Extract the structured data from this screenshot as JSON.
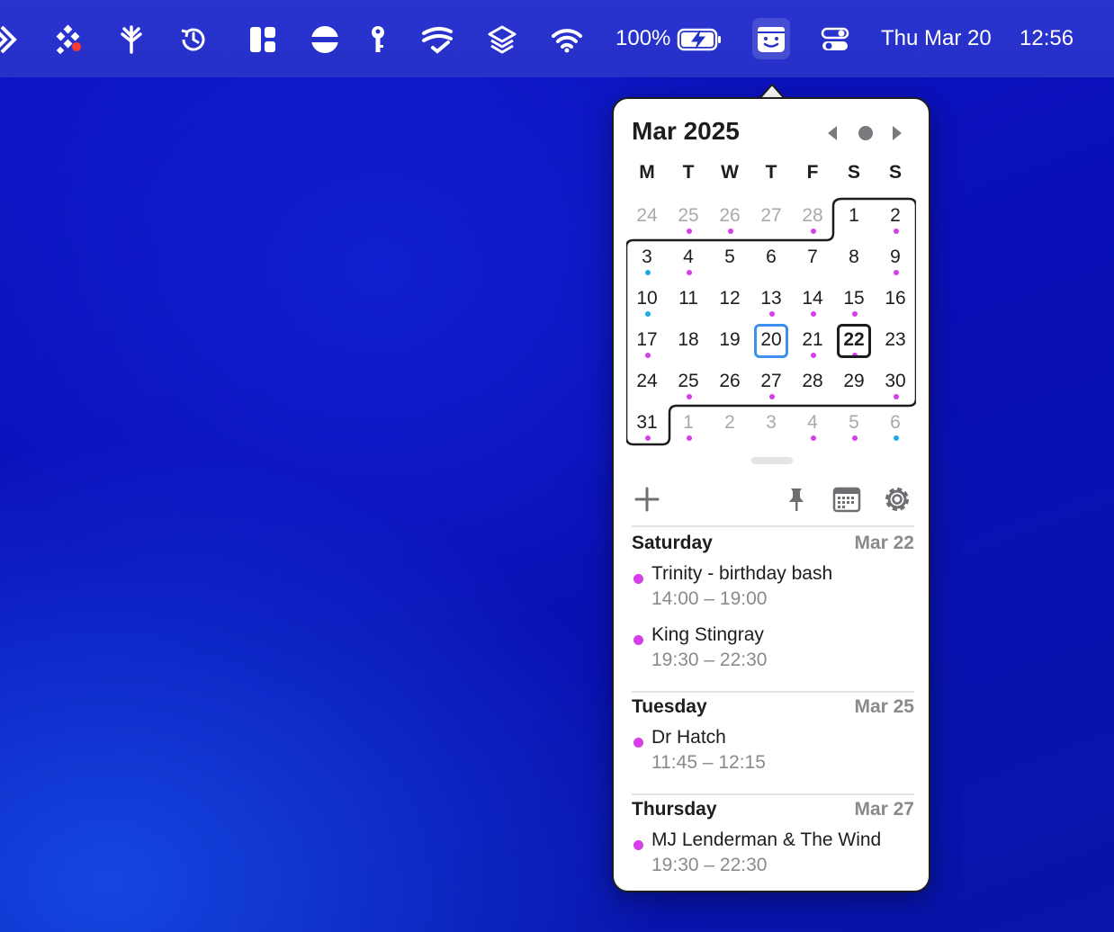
{
  "menubar": {
    "battery_percent": "100%",
    "battery_level": 1.0,
    "date": "Thu Mar 20",
    "time": "12:56",
    "icons": [
      "status-app-icon",
      "grid-notification-icon",
      "bluetooth-fork-icon",
      "time-machine-icon",
      "layout-icon",
      "minus-circle-icon",
      "key-icon",
      "stacked-check-icon",
      "layers-icon",
      "wifi-icon",
      "battery-charging-icon",
      "itsycal-face-icon",
      "control-center-icon"
    ],
    "colors": {
      "notification_dot": "#ff3b30"
    }
  },
  "calendar": {
    "title": "Mar 2025",
    "weekdays": [
      "M",
      "T",
      "W",
      "T",
      "F",
      "S",
      "S"
    ],
    "weeks": [
      [
        {
          "d": "24",
          "other": true
        },
        {
          "d": "25",
          "other": true,
          "dot": "purple"
        },
        {
          "d": "26",
          "other": true,
          "dot": "purple"
        },
        {
          "d": "27",
          "other": true
        },
        {
          "d": "28",
          "other": true,
          "dot": "purple"
        },
        {
          "d": "1"
        },
        {
          "d": "2",
          "dot": "purple"
        }
      ],
      [
        {
          "d": "3",
          "dot": "blue"
        },
        {
          "d": "4",
          "dot": "purple"
        },
        {
          "d": "5"
        },
        {
          "d": "6"
        },
        {
          "d": "7"
        },
        {
          "d": "8"
        },
        {
          "d": "9",
          "dot": "purple"
        }
      ],
      [
        {
          "d": "10",
          "dot": "blue"
        },
        {
          "d": "11"
        },
        {
          "d": "12"
        },
        {
          "d": "13",
          "dot": "purple"
        },
        {
          "d": "14",
          "dot": "purple"
        },
        {
          "d": "15",
          "dot": "purple"
        },
        {
          "d": "16"
        }
      ],
      [
        {
          "d": "17",
          "dot": "purple"
        },
        {
          "d": "18"
        },
        {
          "d": "19"
        },
        {
          "d": "20",
          "today": true
        },
        {
          "d": "21",
          "dot": "purple"
        },
        {
          "d": "22",
          "selected": true,
          "dot": "purple"
        },
        {
          "d": "23"
        }
      ],
      [
        {
          "d": "24"
        },
        {
          "d": "25",
          "dot": "purple"
        },
        {
          "d": "26"
        },
        {
          "d": "27",
          "dot": "purple"
        },
        {
          "d": "28"
        },
        {
          "d": "29"
        },
        {
          "d": "30",
          "dot": "purple"
        }
      ],
      [
        {
          "d": "31",
          "dot": "purple"
        },
        {
          "d": "1",
          "other": true,
          "dot": "purple"
        },
        {
          "d": "2",
          "other": true
        },
        {
          "d": "3",
          "other": true
        },
        {
          "d": "4",
          "other": true,
          "dot": "purple"
        },
        {
          "d": "5",
          "other": true,
          "dot": "purple"
        },
        {
          "d": "6",
          "other": true,
          "dot": "blue"
        }
      ]
    ],
    "colors": {
      "purple": "#d63ee8",
      "blue": "#1fa8e6",
      "today": "#3b8ff0",
      "selected": "#1d1d1f"
    }
  },
  "toolbar": {
    "icons": [
      "plus-icon",
      "pin-icon",
      "calendar-app-icon",
      "gear-icon"
    ]
  },
  "agenda": [
    {
      "day": "Saturday",
      "date": "Mar 22",
      "events": [
        {
          "title": "Trinity - birthday bash",
          "time": "14:00 – 19:00",
          "color": "#d63ee8"
        },
        {
          "title": "King Stingray",
          "time": "19:30 – 22:30",
          "color": "#d63ee8"
        }
      ]
    },
    {
      "day": "Tuesday",
      "date": "Mar 25",
      "events": [
        {
          "title": "Dr Hatch",
          "time": "11:45 – 12:15",
          "color": "#d63ee8"
        }
      ]
    },
    {
      "day": "Thursday",
      "date": "Mar 27",
      "events": [
        {
          "title": "MJ Lenderman & The Wind",
          "time": "19:30 – 22:30",
          "color": "#d63ee8"
        }
      ]
    }
  ]
}
